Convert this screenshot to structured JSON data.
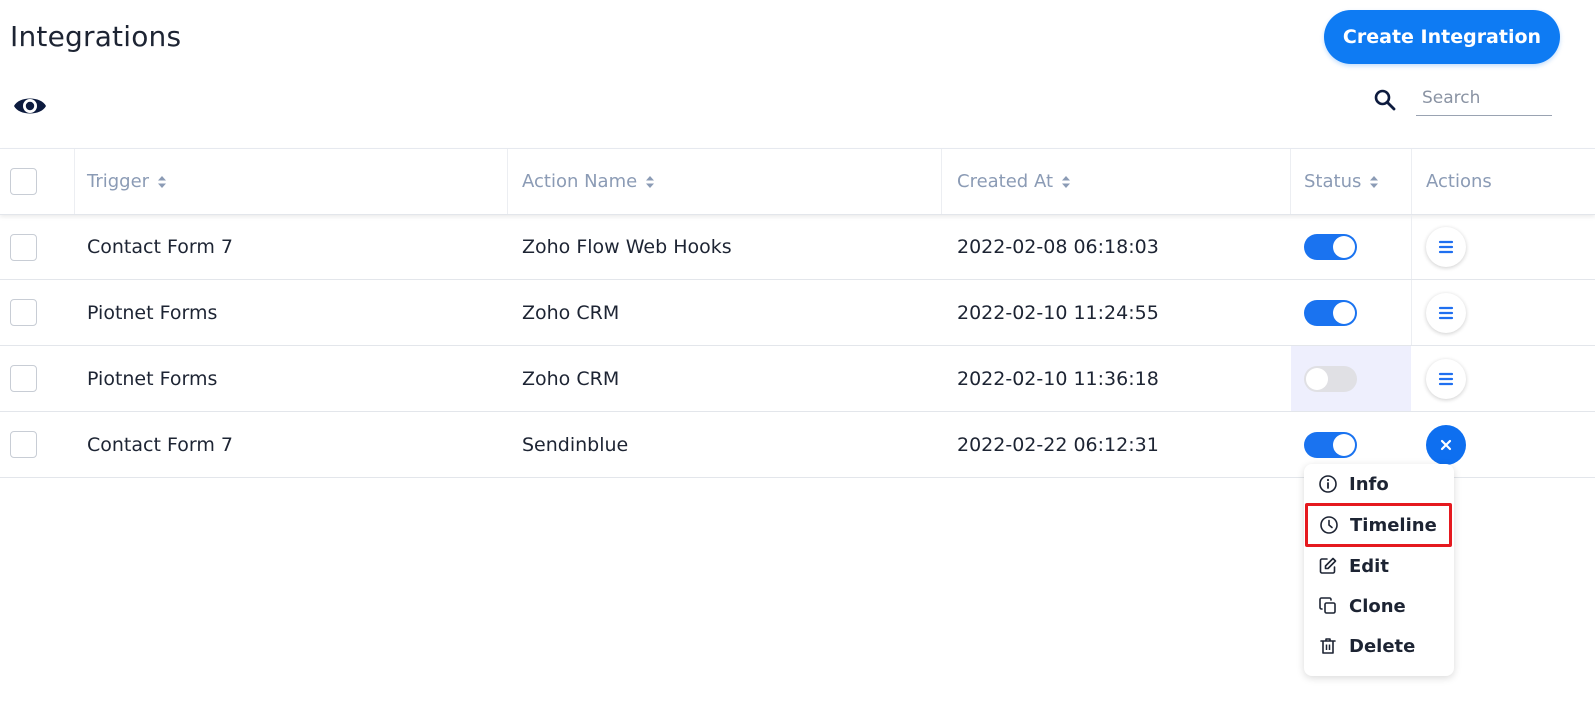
{
  "header": {
    "title": "Integrations",
    "create_label": "Create Integration",
    "search_placeholder": "Search"
  },
  "table": {
    "columns": {
      "trigger": "Trigger",
      "action_name": "Action Name",
      "created_at": "Created At",
      "status": "Status",
      "actions": "Actions"
    },
    "rows": [
      {
        "trigger": "Contact Form 7",
        "action_name": "Zoho Flow Web Hooks",
        "created_at": "2022-02-08 06:18:03",
        "status": "on"
      },
      {
        "trigger": "Piotnet Forms",
        "action_name": "Zoho CRM",
        "created_at": "2022-02-10 11:24:55",
        "status": "on"
      },
      {
        "trigger": "Piotnet Forms",
        "action_name": "Zoho CRM",
        "created_at": "2022-02-10 11:36:18",
        "status": "off"
      },
      {
        "trigger": "Contact Form 7",
        "action_name": "Sendinblue",
        "created_at": "2022-02-22 06:12:31",
        "status": "on"
      }
    ]
  },
  "action_menu": {
    "items": [
      {
        "label": "Info",
        "icon": "info-icon"
      },
      {
        "label": "Timeline",
        "icon": "clock-icon"
      },
      {
        "label": "Edit",
        "icon": "edit-icon"
      },
      {
        "label": "Clone",
        "icon": "clone-icon"
      },
      {
        "label": "Delete",
        "icon": "trash-icon"
      }
    ],
    "selected": "Timeline"
  },
  "colors": {
    "accent": "#0e7bf3",
    "toggle_on": "#1a73f0",
    "toggle_off": "#e0e0e4",
    "header_text": "#8b9bb5",
    "highlight": "#e5191f"
  }
}
